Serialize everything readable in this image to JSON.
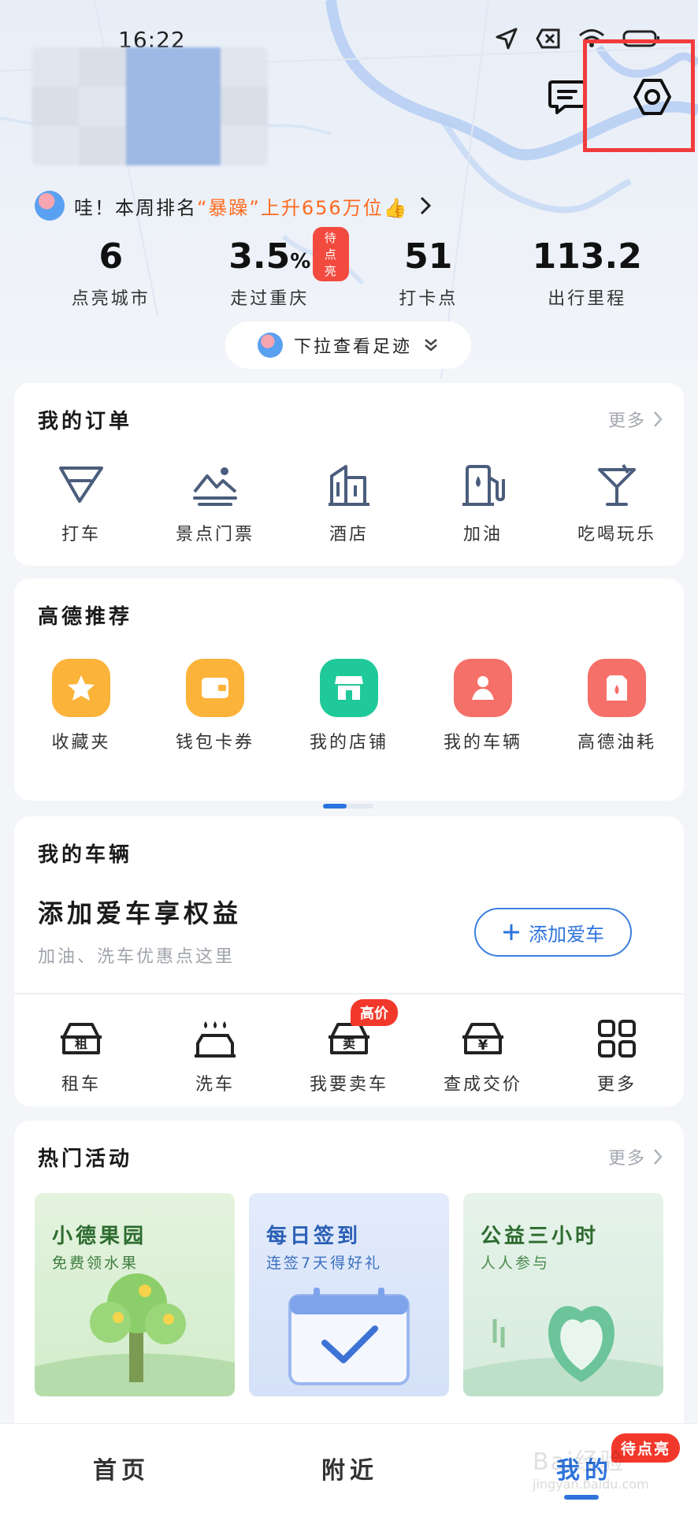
{
  "status_bar": {
    "time": "16:22"
  },
  "header": {
    "messages_icon": "message-icon",
    "settings_icon": "settings-hexagon-icon"
  },
  "rank_banner": {
    "prefix": "哇！本周排名",
    "highlight": "“暴躁”上升656万位",
    "emoji": "👍"
  },
  "stats": [
    {
      "value": "6",
      "unit": "",
      "label": "点亮城市"
    },
    {
      "value": "3.5",
      "unit": "%",
      "label": "走过重庆",
      "badge": "待点亮"
    },
    {
      "value": "51",
      "unit": "",
      "label": "打卡点"
    },
    {
      "value": "113.2",
      "unit": "",
      "label": "出行里程"
    }
  ],
  "pull_button": {
    "label": "下拉查看足迹"
  },
  "orders": {
    "title": "我的订单",
    "more": "更多",
    "items": [
      {
        "label": "打车",
        "icon": "taxi-icon"
      },
      {
        "label": "景点门票",
        "icon": "scenic-ticket-icon"
      },
      {
        "label": "酒店",
        "icon": "hotel-icon"
      },
      {
        "label": "加油",
        "icon": "fuel-icon"
      },
      {
        "label": "吃喝玩乐",
        "icon": "cocktail-icon"
      }
    ]
  },
  "recommend": {
    "title": "高德推荐",
    "items": [
      {
        "label": "收藏夹",
        "icon": "star-icon",
        "color": "#fbb33a"
      },
      {
        "label": "钱包卡券",
        "icon": "wallet-icon",
        "color": "#fbb33a"
      },
      {
        "label": "我的店铺",
        "icon": "store-icon",
        "color": "#20c99a"
      },
      {
        "label": "我的车辆",
        "icon": "person-car-icon",
        "color": "#f6706a"
      },
      {
        "label": "高德油耗",
        "icon": "fuel-can-icon",
        "color": "#f6706a"
      }
    ]
  },
  "vehicle": {
    "title": "我的车辆",
    "headline": "添加爱车享权益",
    "subtitle": "加油、洗车优惠点这里",
    "add_button": "添加爱车",
    "items": [
      {
        "label": "租车",
        "icon": "rent-car-icon"
      },
      {
        "label": "洗车",
        "icon": "car-wash-icon"
      },
      {
        "label": "我要卖车",
        "icon": "sell-car-icon",
        "badge": "高价"
      },
      {
        "label": "查成交价",
        "icon": "car-price-icon"
      },
      {
        "label": "更多",
        "icon": "grid-more-icon"
      }
    ]
  },
  "activities": {
    "title": "热门活动",
    "more": "更多",
    "items": [
      {
        "title": "小德果园",
        "subtitle": "免费领水果",
        "title_color": "#2d6b2f",
        "sub_color": "#3e7d40"
      },
      {
        "title": "每日签到",
        "subtitle": "连签7天得好礼",
        "title_color": "#2a5fb5",
        "sub_color": "#3b6fc0"
      },
      {
        "title": "公益三小时",
        "subtitle": "人人参与",
        "title_color": "#2d6b2f",
        "sub_color": "#4a8a4c"
      }
    ]
  },
  "bottom_nav": {
    "items": [
      "首页",
      "附近",
      "我的"
    ],
    "badge": "待点亮"
  },
  "watermark": {
    "text": "Bai经验",
    "url": "jingyan.baidu.com"
  }
}
